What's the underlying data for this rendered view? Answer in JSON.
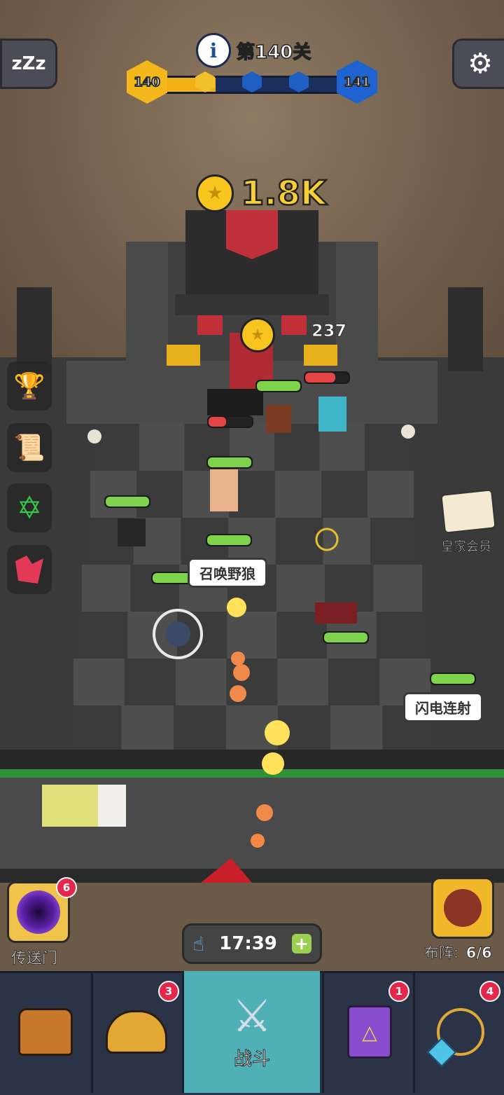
{
  "header": {
    "level_title": "第140关",
    "current_level": "140",
    "next_level": "141",
    "progress_fraction": 0.28
  },
  "reward": {
    "amount": "1.8K"
  },
  "damage_number": "237",
  "skills": {
    "wolf": "召唤野狼",
    "lightning": "闪电连射"
  },
  "right_panel": {
    "vip_label": "皇家会员"
  },
  "portal": {
    "label": "传送门",
    "badge": "6"
  },
  "formation": {
    "label": "布阵:",
    "value": "6/6"
  },
  "timer": {
    "value": "17:39"
  },
  "nav": {
    "items": [
      {
        "label": "",
        "icon": "treasure-chest-icon",
        "badge": ""
      },
      {
        "label": "",
        "icon": "winged-helmet-icon",
        "badge": "3"
      },
      {
        "label": "战斗",
        "icon": "crossed-swords-icon",
        "badge": ""
      },
      {
        "label": "",
        "icon": "spellbook-icon",
        "badge": "1"
      },
      {
        "label": "",
        "icon": "amulet-icon",
        "badge": "4"
      }
    ],
    "active_index": 2
  },
  "colors": {
    "nav_bg": "#2b3447",
    "nav_active": "#4fb1b7",
    "hp_green": "#7fd24b",
    "badge_red": "#e5274b"
  }
}
